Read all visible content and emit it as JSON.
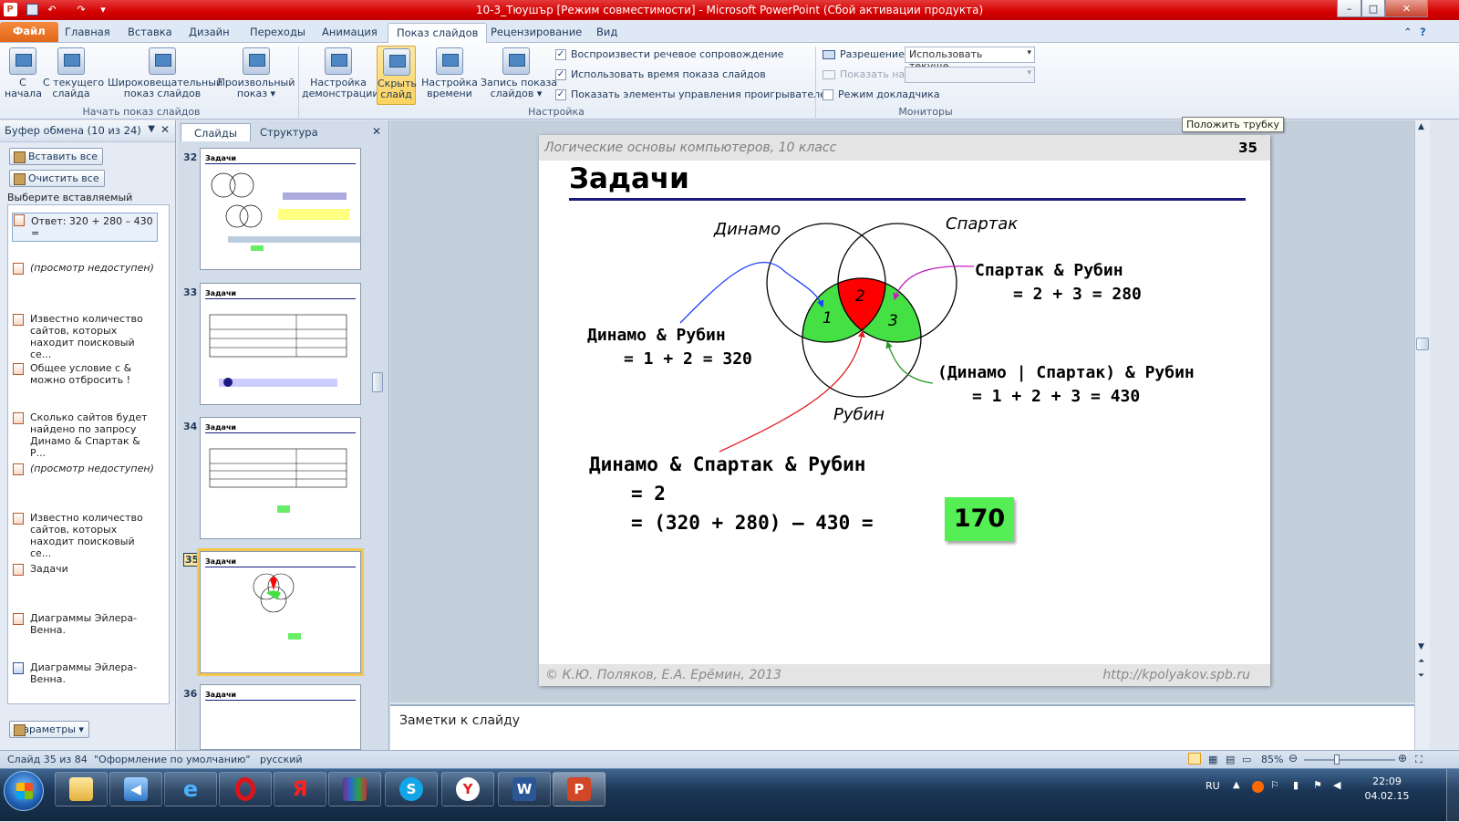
{
  "window": {
    "title": "10-3_Тюушър [Режим совместимости] - Microsoft PowerPoint (Сбой активации продукта)",
    "minimize_glyph": "–",
    "maximize_glyph": "□",
    "close_glyph": "✕"
  },
  "tabs": [
    "Файл",
    "Главная",
    "Вставка",
    "Дизайн",
    "Переходы",
    "Анимация",
    "Показ слайдов",
    "Рецензирование",
    "Вид"
  ],
  "active_tab": "Показ слайдов",
  "ribbon": {
    "start_from_begin": "С\nначала",
    "start_from_current": "С текущего\nслайда",
    "broadcast": "Широковещательный\nпоказ слайдов",
    "custom_show": "Произвольный\nпоказ ▾",
    "group_start": "Начать показ слайдов",
    "setup_show": "Настройка\nдемонстрации",
    "hide_slide": "Скрыть\nслайд",
    "rehearse": "Настройка\nвремени",
    "record": "Запись показа\nслайдов ▾",
    "check_narration": "Воспроизвести речевое сопровождение",
    "check_timings": "Использовать время показа слайдов",
    "check_controls": "Показать элементы управления проигрывателем",
    "group_setup": "Настройка",
    "resolution_label": "Разрешение:",
    "resolution_value": "Использовать текуще...",
    "show_on_label": "Показать на:",
    "presenter_view": "Режим докладчика",
    "group_monitors": "Мониторы"
  },
  "tooltip": "Положить трубку",
  "clipboard": {
    "title": "Буфер обмена (10 из 24)",
    "paste_all": "Вставить все",
    "clear_all": "Очистить все",
    "prompt": "Выберите вставляемый объект:",
    "items": [
      {
        "text": "Ответ: 320 + 280 – 430 =",
        "italic": false,
        "icon": "ppt"
      },
      {
        "text": "(просмотр недоступен)",
        "italic": true,
        "icon": "ppt"
      },
      {
        "text": "Известно количество сайтов, которых находит поисковый се...",
        "italic": false,
        "icon": "ppt"
      },
      {
        "text": "Общее условие с & можно отбросить !",
        "italic": false,
        "icon": "ppt"
      },
      {
        "text": "Сколько сайтов будет найдено по запросу Динамо & Спартак & Р...",
        "italic": false,
        "icon": "ppt"
      },
      {
        "text": "(просмотр недоступен)",
        "italic": true,
        "icon": "ppt"
      },
      {
        "text": "Известно количество сайтов, которых находит поисковый се...",
        "italic": false,
        "icon": "ppt"
      },
      {
        "text": "Задачи",
        "italic": false,
        "icon": "ppt"
      },
      {
        "text": "Диаграммы Эйлера-Венна.",
        "italic": false,
        "icon": "ppt"
      },
      {
        "text": "Диаграммы Эйлера-Венна.",
        "italic": false,
        "icon": "word"
      }
    ],
    "options": "Параметры ▾"
  },
  "slide_panel": {
    "tab_slides": "Слайды",
    "tab_outline": "Структура",
    "thumbs": [
      {
        "num": "32",
        "title": "Задачи"
      },
      {
        "num": "33",
        "title": "Задачи"
      },
      {
        "num": "34",
        "title": "Задачи"
      },
      {
        "num": "35",
        "title": "Задачи"
      },
      {
        "num": "36",
        "title": "Задачи"
      }
    ]
  },
  "slide": {
    "header": "Логические основы компьютеров, 10 класс",
    "number": "35",
    "title": "Задачи",
    "label_dinamo": "Динамо",
    "label_spartak": "Спартак",
    "label_rubin": "Рубин",
    "region1": "1",
    "region2": "2",
    "region3": "3",
    "sr_line1": "Спартак & Рубин",
    "sr_line2": "= 2 + 3 = 280",
    "dr_line1": "Динамо & Рубин",
    "dr_line2": "= 1 + 2 = 320",
    "dsr_line1": "(Динамо | Спартак) & Рубин",
    "dsr_line2": "= 1 + 2 + 3 = 430",
    "all_line1": "Динамо & Спартак & Рубин",
    "all_line2": "= 2",
    "all_line3": "= (320 + 280) – 430 =",
    "answer": "170",
    "footer_left": "© К.Ю. Поляков, Е.А. Ерёмин, 2013",
    "footer_right": "http://kpolyakov.spb.ru"
  },
  "notes_placeholder": "Заметки к слайду",
  "status": {
    "slide_of": "Слайд 35 из 84",
    "theme": "\"Оформление по умолчанию\"",
    "language": "русский",
    "zoom": "85%"
  },
  "tray": {
    "lang": "RU",
    "time": "22:09",
    "date": "04.02.15"
  },
  "colors": {
    "title_bar": "#d40000",
    "venn_green": "#44e044",
    "venn_red": "#ff0000",
    "answer_green": "#55ee55",
    "underline": "#1a1a80"
  }
}
